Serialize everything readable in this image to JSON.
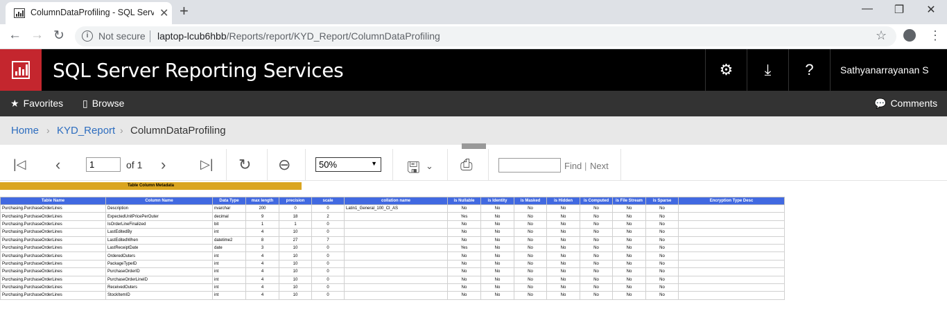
{
  "browser": {
    "tab_title": "ColumnDataProfiling - SQL Server Reporting Services",
    "not_secure": "Not secure",
    "url_host": "laptop-lcub6hbb",
    "url_path": "/Reports/report/KYD_Report/ColumnDataProfiling"
  },
  "header": {
    "app_title": "SQL Server Reporting Services",
    "user_name": "Sathyanarrayanan S"
  },
  "nav": {
    "favorites": "Favorites",
    "browse": "Browse",
    "comments": "Comments"
  },
  "breadcrumb": {
    "home": "Home",
    "folder": "KYD_Report",
    "current": "ColumnDataProfiling"
  },
  "report_toolbar": {
    "page_value": "1",
    "of_pages": "of 1",
    "zoom": "50%",
    "find": "Find",
    "find_sep": "|",
    "next": "Next"
  },
  "report": {
    "title": "Table Column Metadata",
    "columns": [
      "Table Name",
      "Column Name",
      "Data Type",
      "max length",
      "precision",
      "scale",
      "collation name",
      "is Nullable",
      "is Identity",
      "is Masked",
      "is Hidden",
      "is Computed",
      "is File Stream",
      "is Sparse",
      "Encryption Type Desc"
    ],
    "rows": [
      [
        "Purchasing.PurchaseOrderLines",
        "Description",
        "nvarchar",
        "200",
        "0",
        "0",
        "Latin1_General_100_CI_AS",
        "No",
        "No",
        "No",
        "No",
        "No",
        "No",
        "No",
        ""
      ],
      [
        "Purchasing.PurchaseOrderLines",
        "ExpectedUnitPricePerOuter",
        "decimal",
        "9",
        "18",
        "2",
        "",
        "Yes",
        "No",
        "No",
        "No",
        "No",
        "No",
        "No",
        ""
      ],
      [
        "Purchasing.PurchaseOrderLines",
        "IsOrderLineFinalized",
        "bit",
        "1",
        "1",
        "0",
        "",
        "No",
        "No",
        "No",
        "No",
        "No",
        "No",
        "No",
        ""
      ],
      [
        "Purchasing.PurchaseOrderLines",
        "LastEditedBy",
        "int",
        "4",
        "10",
        "0",
        "",
        "No",
        "No",
        "No",
        "No",
        "No",
        "No",
        "No",
        ""
      ],
      [
        "Purchasing.PurchaseOrderLines",
        "LastEditedWhen",
        "datetime2",
        "8",
        "27",
        "7",
        "",
        "No",
        "No",
        "No",
        "No",
        "No",
        "No",
        "No",
        ""
      ],
      [
        "Purchasing.PurchaseOrderLines",
        "LastReceiptDate",
        "date",
        "3",
        "10",
        "0",
        "",
        "Yes",
        "No",
        "No",
        "No",
        "No",
        "No",
        "No",
        ""
      ],
      [
        "Purchasing.PurchaseOrderLines",
        "OrderedOuters",
        "int",
        "4",
        "10",
        "0",
        "",
        "No",
        "No",
        "No",
        "No",
        "No",
        "No",
        "No",
        ""
      ],
      [
        "Purchasing.PurchaseOrderLines",
        "PackageTypeID",
        "int",
        "4",
        "10",
        "0",
        "",
        "No",
        "No",
        "No",
        "No",
        "No",
        "No",
        "No",
        ""
      ],
      [
        "Purchasing.PurchaseOrderLines",
        "PurchaseOrderID",
        "int",
        "4",
        "10",
        "0",
        "",
        "No",
        "No",
        "No",
        "No",
        "No",
        "No",
        "No",
        ""
      ],
      [
        "Purchasing.PurchaseOrderLines",
        "PurchaseOrderLineID",
        "int",
        "4",
        "10",
        "0",
        "",
        "No",
        "No",
        "No",
        "No",
        "No",
        "No",
        "No",
        ""
      ],
      [
        "Purchasing.PurchaseOrderLines",
        "ReceivedOuters",
        "int",
        "4",
        "10",
        "0",
        "",
        "No",
        "No",
        "No",
        "No",
        "No",
        "No",
        "No",
        ""
      ],
      [
        "Purchasing.PurchaseOrderLines",
        "StockItemID",
        "int",
        "4",
        "10",
        "0",
        "",
        "No",
        "No",
        "No",
        "No",
        "No",
        "No",
        "No",
        ""
      ]
    ],
    "header_color": "#4169e1",
    "banner_color": "#daa520"
  },
  "icons": {
    "back": "arrow-left-icon",
    "forward": "arrow-right-icon",
    "reload": "reload-icon",
    "bookmark": "star-icon",
    "settings": "gear-icon",
    "download": "download-icon",
    "help": "help-icon"
  },
  "colors": {
    "brand_red": "#c4262e",
    "header_bg": "#000000",
    "nav_bg": "#333333",
    "link_blue": "#2d6dbf"
  }
}
